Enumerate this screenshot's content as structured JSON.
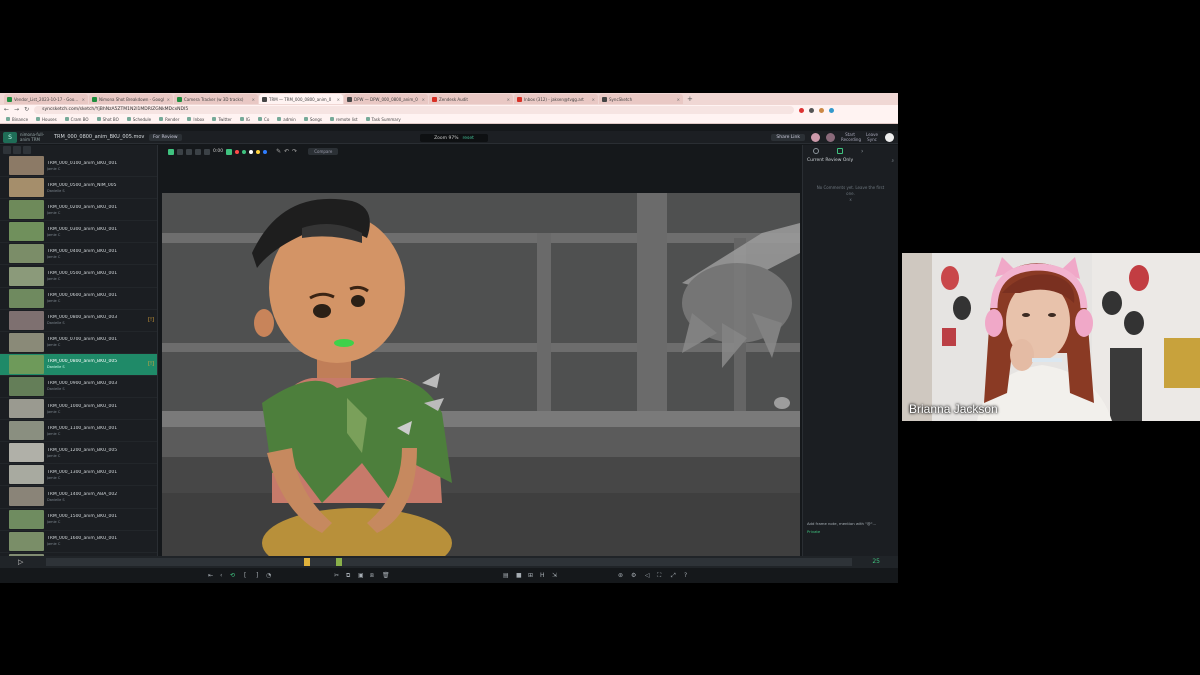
{
  "browser": {
    "tabs": [
      {
        "label": "Vendor_List_2023-10-17 - Google",
        "color": "#1e8e3e",
        "active": false
      },
      {
        "label": "Nimona Shot Breakdown - Googl",
        "color": "#1e8e3e",
        "active": false
      },
      {
        "label": "Camera Tracker (w 3D tracks)",
        "color": "#1e8e3e",
        "active": false
      },
      {
        "label": "TRM — TRM_000_0800_anim_0",
        "color": "#444444",
        "active": true
      },
      {
        "label": "DPW — DPW_000_0800_anim_0",
        "color": "#444444",
        "active": false
      },
      {
        "label": "Zendesk Audit",
        "color": "#d93025",
        "active": false
      },
      {
        "label": "Inbox (312) - jaksen@tvgg.art",
        "color": "#d93025",
        "active": false
      },
      {
        "label": "SyncSketch",
        "color": "#444444",
        "active": false
      }
    ],
    "new_tab": "+",
    "url": "syncsketch.com/sketch/YjBhNzA5ZTM1N2I1MDRlZGNkMDcxNDI5",
    "bookmarks": [
      "Binance",
      "Houses",
      "Cram BO",
      "Shot BO",
      "Schedule",
      "Render",
      "Inbox",
      "Twitter",
      "IG",
      "Co",
      "admin",
      "Songs",
      "remote list",
      "Task Summary"
    ]
  },
  "app": {
    "project": "nimona-full-anim TRM",
    "file_title": "TRM_000_0800_anim_BKU_005.mov",
    "status": "For Review",
    "zoom_label": "Zoom 97%",
    "zoom_reset": "reset",
    "frame_readout": "0:00",
    "compare_label": "Compare",
    "view_link": "Share Link",
    "start_recording": "Start Recording",
    "leave_sync": "Leave Sync"
  },
  "shots": [
    {
      "name": "TRM_000_0100_anim_BKU_001",
      "artist": "Jamie C",
      "thumb": "#8c7a66",
      "selected": false,
      "flag": ""
    },
    {
      "name": "TRM_000_0500_anim_NIM_005",
      "artist": "Danielle S",
      "thumb": "#a58e6b",
      "selected": false,
      "flag": ""
    },
    {
      "name": "TRM_000_0200_anim_BKU_001",
      "artist": "Jamie C",
      "thumb": "#6e8a5a",
      "selected": false,
      "flag": ""
    },
    {
      "name": "TRM_000_0300_anim_BKU_001",
      "artist": "Jamie C",
      "thumb": "#70905c",
      "selected": false,
      "flag": ""
    },
    {
      "name": "TRM_000_0400_anim_BKU_001",
      "artist": "Jamie C",
      "thumb": "#7b8d68",
      "selected": false,
      "flag": ""
    },
    {
      "name": "TRM_000_0500_anim_BKU_001",
      "artist": "Jamie C",
      "thumb": "#8b9a7a",
      "selected": false,
      "flag": ""
    },
    {
      "name": "TRM_000_0600_anim_BKU_001",
      "artist": "Jamie C",
      "thumb": "#6f8a5f",
      "selected": false,
      "flag": ""
    },
    {
      "name": "TRM_000_0800_anim_BKU_003",
      "artist": "Danielle S",
      "thumb": "#7e7070",
      "selected": false,
      "flag": "[!]"
    },
    {
      "name": "TRM_000_0700_anim_BKU_001",
      "artist": "Jamie C",
      "thumb": "#8a8a78",
      "selected": false,
      "flag": ""
    },
    {
      "name": "TRM_000_0800_anim_BKU_005",
      "artist": "Danielle S",
      "thumb": "#6e9a5a",
      "selected": true,
      "flag": "[!]"
    },
    {
      "name": "TRM_000_0900_anim_BKU_003",
      "artist": "Danielle S",
      "thumb": "#647e58",
      "selected": false,
      "flag": ""
    },
    {
      "name": "TRM_000_1000_anim_BKU_001",
      "artist": "Jamie C",
      "thumb": "#9a9a90",
      "selected": false,
      "flag": ""
    },
    {
      "name": "TRM_000_1100_anim_BKU_001",
      "artist": "Jamie C",
      "thumb": "#8a8f80",
      "selected": false,
      "flag": ""
    },
    {
      "name": "TRM_000_1200_anim_BKU_005",
      "artist": "Jamie C",
      "thumb": "#b0b0a8",
      "selected": false,
      "flag": ""
    },
    {
      "name": "TRM_000_1300_anim_BKU_001",
      "artist": "Jamie C",
      "thumb": "#a8aaa0",
      "selected": false,
      "flag": ""
    },
    {
      "name": "TRM_000_1400_anim_ABA_002",
      "artist": "Danielle S",
      "thumb": "#8a8478",
      "selected": false,
      "flag": ""
    },
    {
      "name": "TRM_000_1500_anim_BKU_001",
      "artist": "Jamie C",
      "thumb": "#6f8c60",
      "selected": false,
      "flag": ""
    },
    {
      "name": "TRM_000_1600_anim_BKU_001",
      "artist": "Jamie C",
      "thumb": "#7a8e68",
      "selected": false,
      "flag": ""
    },
    {
      "name": "TRM_000_1700_anim_BKU_001",
      "artist": "Jamie C",
      "thumb": "#818c72",
      "selected": false,
      "flag": ""
    }
  ],
  "review": {
    "filter_label": "Current Review Only",
    "empty_text": "No Comments yet. Leave the first one.",
    "empty_icon": "x",
    "add_note": "Add frame note, mention with \"@\"...",
    "private_label": "Private"
  },
  "timeline": {
    "end_frame": "25",
    "current_frame": "25",
    "playhead_fraction": 0.32,
    "marker_fraction": 0.36
  },
  "webcam": {
    "name": "Brianna Jackson"
  },
  "colors": {
    "accent": "#3fc27f",
    "selection": "#1f8a68",
    "panel": "#1b1e22"
  }
}
